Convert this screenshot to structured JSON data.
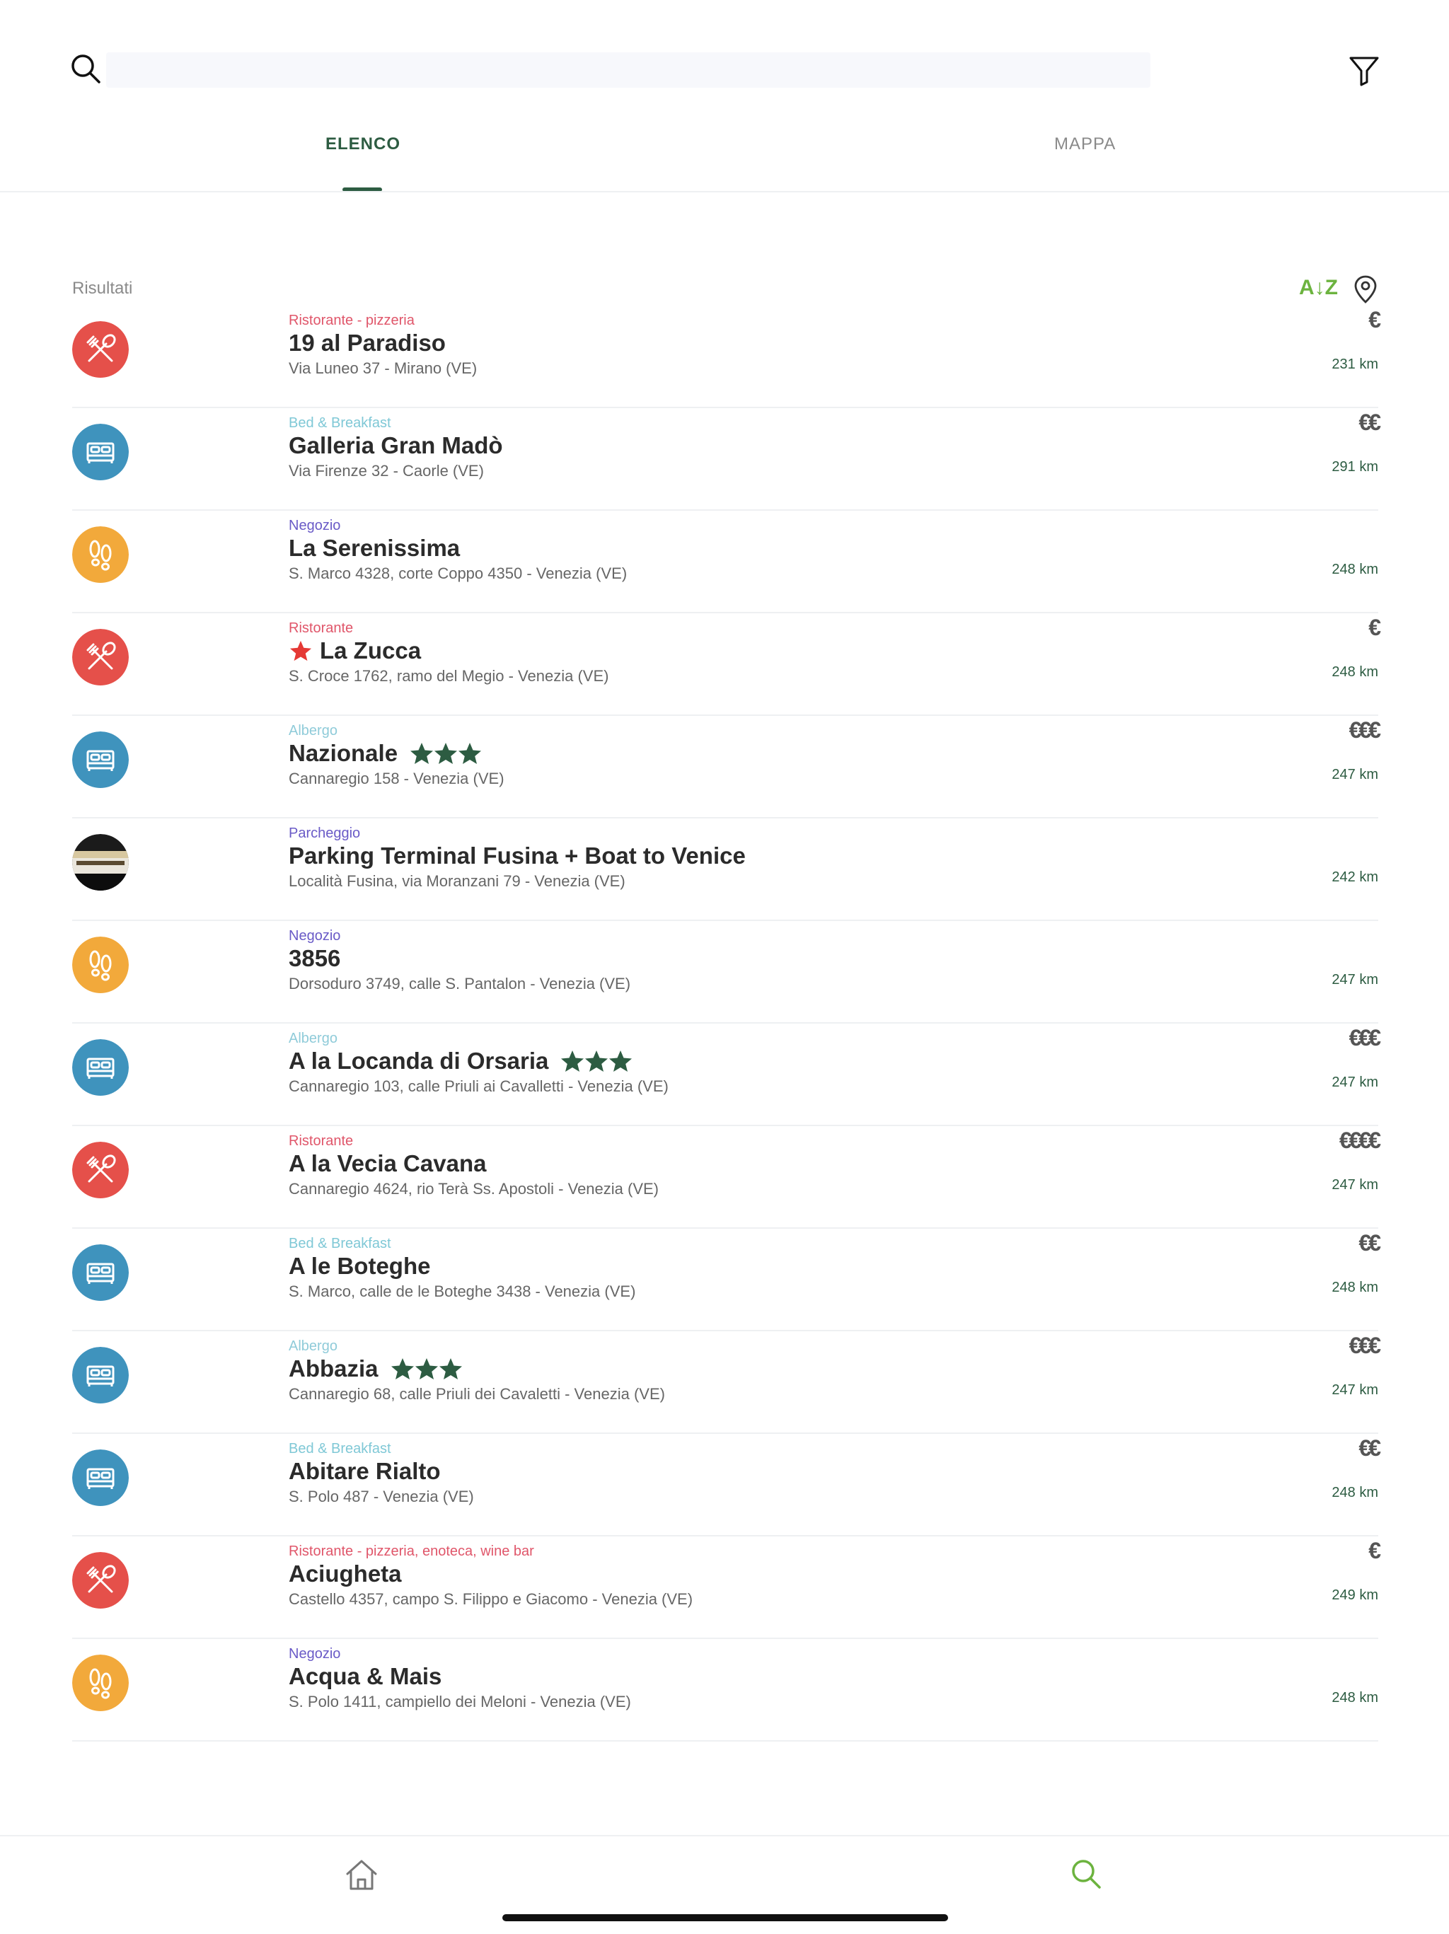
{
  "search": {
    "placeholder": "",
    "value": ""
  },
  "tabs": [
    {
      "label": "ELENCO",
      "active": true
    },
    {
      "label": "MAPPA",
      "active": false
    }
  ],
  "results": {
    "label": "Risultati",
    "sort_label": "A↓Z"
  },
  "colors": {
    "accent": "#2d5c42",
    "sort_green": "#6cb33f",
    "restaurant": "#e5504a",
    "hotel": "#3f93bd",
    "shop": "#f2a93b",
    "cat_restaurant_text": "#e0566a",
    "cat_bnb_text": "#7fc8d6",
    "cat_shop_text": "#6a5bc7",
    "cat_hotel_text": "#8fcbd9",
    "star_green": "#2d5c42",
    "fav_red": "#e53935"
  },
  "items": [
    {
      "kind": "restaurant",
      "icon": "fork-knife-icon",
      "category": "Ristorante - pizzeria",
      "name": "19 al Paradiso",
      "address": "Via Luneo 37 - Mirano (VE)",
      "price": "€",
      "distance": "231 km",
      "stars": 0,
      "favorite": false
    },
    {
      "kind": "hotel",
      "icon": "bed-icon",
      "category": "Bed & Breakfast",
      "name": "Galleria Gran Madò",
      "address": "Via Firenze 32 - Caorle (VE)",
      "price": "€€",
      "distance": "291 km",
      "stars": 0,
      "favorite": false
    },
    {
      "kind": "shop",
      "icon": "footprints-icon",
      "category": "Negozio",
      "name": "La Serenissima",
      "address": "S. Marco 4328, corte Coppo 4350 - Venezia (VE)",
      "price": "",
      "distance": "248 km",
      "stars": 0,
      "favorite": false
    },
    {
      "kind": "restaurant",
      "icon": "fork-knife-icon",
      "category": "Ristorante",
      "name": "La Zucca",
      "address": "S. Croce 1762, ramo del Megio - Venezia (VE)",
      "price": "€",
      "distance": "248 km",
      "stars": 0,
      "favorite": true
    },
    {
      "kind": "hotel",
      "icon": "bed-icon",
      "category": "Albergo",
      "name": "Nazionale",
      "address": "Cannaregio 158 - Venezia (VE)",
      "price": "€€€",
      "distance": "247 km",
      "stars": 3,
      "favorite": false
    },
    {
      "kind": "parking",
      "icon": "parking-photo-icon",
      "category": "Parcheggio",
      "name": "Parking Terminal Fusina + Boat to Venice",
      "address": "Località Fusina, via Moranzani 79 - Venezia (VE)",
      "price": "",
      "distance": "242 km",
      "stars": 0,
      "favorite": false
    },
    {
      "kind": "shop",
      "icon": "footprints-icon",
      "category": "Negozio",
      "name": "3856",
      "address": "Dorsoduro 3749, calle S. Pantalon - Venezia (VE)",
      "price": "",
      "distance": "247 km",
      "stars": 0,
      "favorite": false
    },
    {
      "kind": "hotel",
      "icon": "bed-icon",
      "category": "Albergo",
      "name": "A la Locanda di Orsaria",
      "address": "Cannaregio 103, calle Priuli ai Cavalletti - Venezia (VE)",
      "price": "€€€",
      "distance": "247 km",
      "stars": 3,
      "favorite": false
    },
    {
      "kind": "restaurant",
      "icon": "fork-knife-icon",
      "category": "Ristorante",
      "name": "A la Vecia Cavana",
      "address": "Cannaregio 4624, rio Terà Ss. Apostoli - Venezia (VE)",
      "price": "€€€€",
      "distance": "247 km",
      "stars": 0,
      "favorite": false
    },
    {
      "kind": "hotel",
      "icon": "bed-icon",
      "category": "Bed & Breakfast",
      "name": "A le Boteghe",
      "address": "S. Marco, calle de le Boteghe 3438 - Venezia (VE)",
      "price": "€€",
      "distance": "248 km",
      "stars": 0,
      "favorite": false
    },
    {
      "kind": "hotel",
      "icon": "bed-icon",
      "category": "Albergo",
      "name": "Abbazia",
      "address": "Cannaregio 68, calle Priuli dei Cavaletti - Venezia (VE)",
      "price": "€€€",
      "distance": "247 km",
      "stars": 3,
      "favorite": false
    },
    {
      "kind": "hotel",
      "icon": "bed-icon",
      "category": "Bed & Breakfast",
      "name": "Abitare Rialto",
      "address": "S. Polo 487 - Venezia (VE)",
      "price": "€€",
      "distance": "248 km",
      "stars": 0,
      "favorite": false
    },
    {
      "kind": "restaurant",
      "icon": "fork-knife-icon",
      "category": "Ristorante - pizzeria, enoteca, wine bar",
      "name": "Aciugheta",
      "address": "Castello 4357, campo S. Filippo e Giacomo - Venezia (VE)",
      "price": "€",
      "distance": "249 km",
      "stars": 0,
      "favorite": false
    },
    {
      "kind": "shop",
      "icon": "footprints-icon",
      "category": "Negozio",
      "name": "Acqua & Mais",
      "address": "S. Polo 1411, campiello dei Meloni - Venezia (VE)",
      "price": "",
      "distance": "248 km",
      "stars": 0,
      "favorite": false
    }
  ]
}
